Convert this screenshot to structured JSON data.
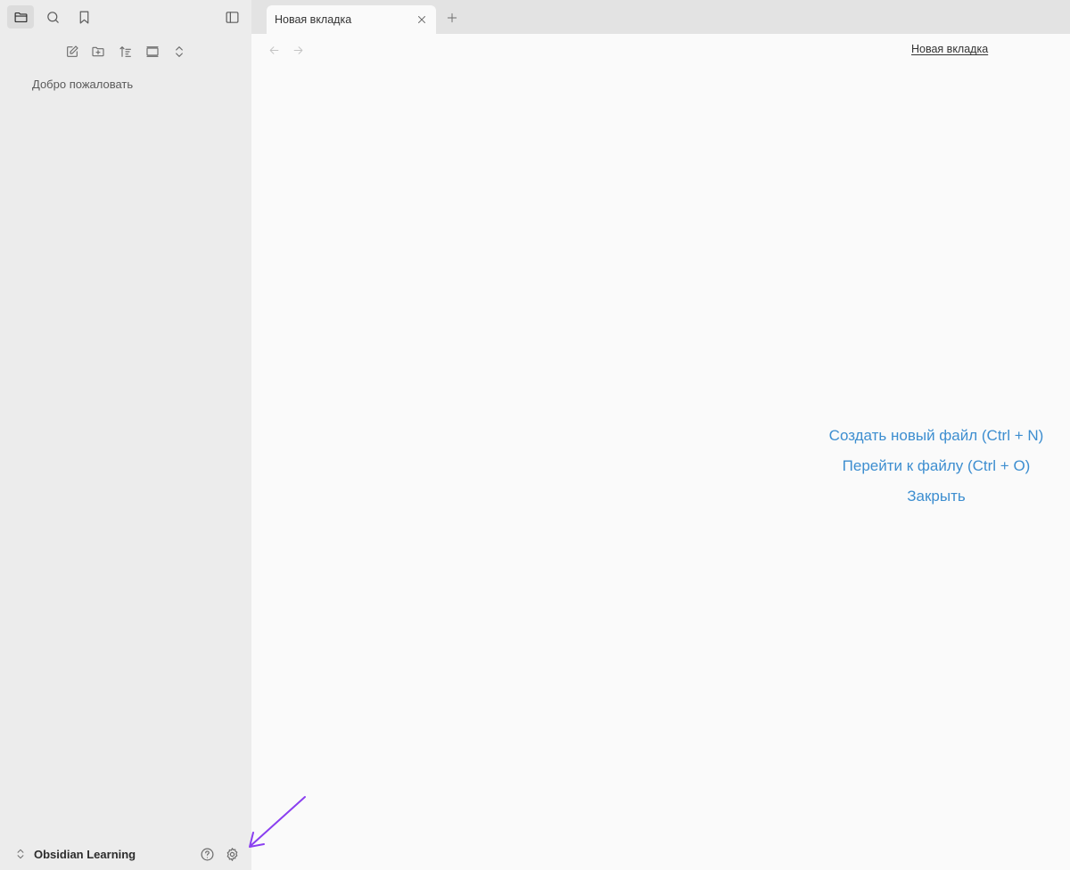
{
  "sidebar": {
    "tabs": [
      {
        "icon": "folder-icon",
        "name": "files-tab"
      },
      {
        "icon": "search-icon",
        "name": "search-tab"
      },
      {
        "icon": "bookmark-icon",
        "name": "bookmarks-tab"
      }
    ],
    "files": [
      {
        "label": "Добро пожаловать"
      }
    ],
    "vault_name": "Obsidian Learning"
  },
  "tab": {
    "title": "Новая вкладка"
  },
  "view": {
    "title": "Новая вкладка",
    "actions": {
      "create": "Создать новый файл (Ctrl + N)",
      "goto": "Перейти к файлу (Ctrl + O)",
      "close": "Закрыть"
    }
  },
  "colors": {
    "accent": "#3d8ed0",
    "annotation": "#8a3ff0"
  }
}
